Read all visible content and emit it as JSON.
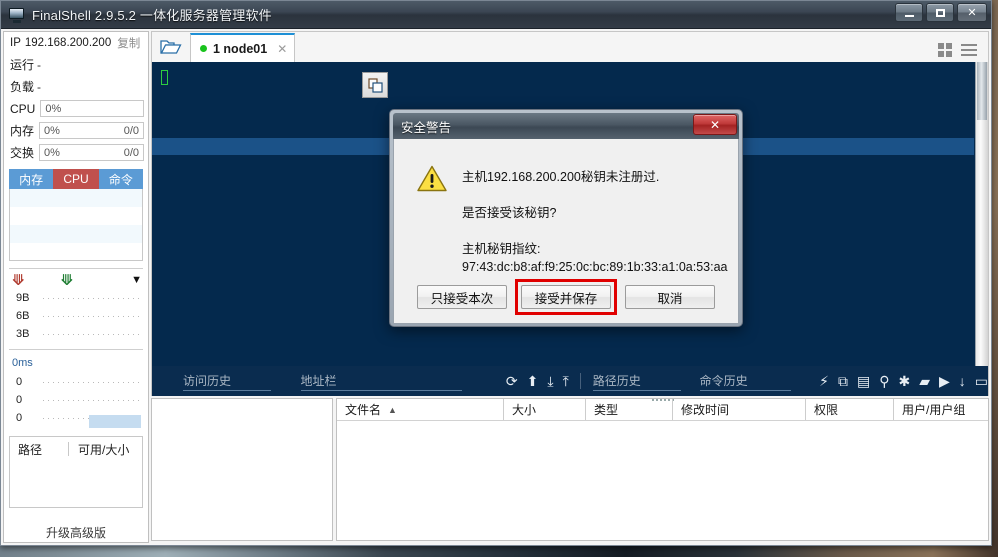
{
  "window": {
    "title": "FinalShell 2.9.5.2 一体化服务器管理软件",
    "icon": "monitor-icon",
    "minimize_label": "",
    "maximize_label": "",
    "close_label": "✕"
  },
  "sidebar": {
    "ip_label": "IP",
    "ip_value": "192.168.200.200",
    "copy_label": "复制",
    "uptime_label": "运行",
    "uptime_value": "-",
    "load_label": "负载",
    "load_value": "-",
    "meters": [
      {
        "label": "CPU",
        "percent": "0%",
        "detail": ""
      },
      {
        "label": "内存",
        "percent": "0%",
        "detail": "0/0"
      },
      {
        "label": "交换",
        "percent": "0%",
        "detail": "0/0"
      }
    ],
    "proc_tabs": [
      {
        "label": "内存",
        "active": false
      },
      {
        "label": "CPU",
        "active": true
      },
      {
        "label": "命令",
        "active": false
      }
    ],
    "net_up_icon": "arrow-up-icon",
    "net_down_icon": "arrow-down-icon",
    "net_menu_icon": "chevron-down-icon",
    "net_axis": [
      "9B",
      "6B",
      "3B"
    ],
    "latency_label": "0ms",
    "latency_axis": [
      "0",
      "0",
      "0"
    ],
    "disk_headers": [
      "路径",
      "可用/大小"
    ],
    "upgrade_label": "升级高级版"
  },
  "tabbar": {
    "folder_icon": "open-folder-icon",
    "tabs": [
      {
        "status": "connected",
        "label": "1 node01",
        "close": "✕"
      }
    ],
    "grid_view_icon": "grid-view-icon",
    "list_view_icon": "list-view-icon"
  },
  "terminal": {
    "background": "#04294d",
    "cursor_color": "#2ecc40",
    "selection_color": "#1b5288",
    "copy_icon": "copy-icon"
  },
  "sftp_toolbar": {
    "visit_history_placeholder": "访问历史",
    "address_bar_placeholder": "地址栏",
    "path_history_placeholder": "路径历史",
    "command_history_placeholder": "命令历史",
    "left_icons": [
      {
        "name": "refresh-icon",
        "glyph": "⟳"
      },
      {
        "name": "upload-arrow-icon",
        "glyph": "⬆"
      },
      {
        "name": "download-tray-icon",
        "glyph": "⤓"
      },
      {
        "name": "upload-tray-icon",
        "glyph": "⤒"
      }
    ],
    "right_icons": [
      {
        "name": "lightning-icon",
        "glyph": "⚡"
      },
      {
        "name": "copy-files-icon",
        "glyph": "⧉"
      },
      {
        "name": "paste-files-icon",
        "glyph": "▤"
      },
      {
        "name": "search-icon",
        "glyph": "⚲"
      },
      {
        "name": "gear-icon",
        "glyph": "✱"
      },
      {
        "name": "open-folder-icon",
        "glyph": "▰"
      },
      {
        "name": "play-icon",
        "glyph": "▶"
      },
      {
        "name": "download-icon",
        "glyph": "↓"
      },
      {
        "name": "window-icon",
        "glyph": "▭"
      }
    ]
  },
  "file_list": {
    "columns": [
      {
        "label": "文件名",
        "sorted": true,
        "sort_dir": "▲"
      },
      {
        "label": "大小"
      },
      {
        "label": "类型"
      },
      {
        "label": "修改时间"
      },
      {
        "label": "权限"
      },
      {
        "label": "用户/用户组"
      }
    ],
    "rows": []
  },
  "dialog": {
    "title": "安全警告",
    "close_label": "✕",
    "icon": "warning-triangle-icon",
    "line1": "主机192.168.200.200秘钥未注册过.",
    "line2": "是否接受该秘钥?",
    "line3": "主机秘钥指纹:",
    "fingerprint": "97:43:dc:b8:af:f9:25:0c:bc:89:1b:33:a1:0a:53:aa",
    "buttons": [
      {
        "label": "只接受本次",
        "highlighted": false
      },
      {
        "label": "接受并保存",
        "highlighted": true
      },
      {
        "label": "取消",
        "highlighted": false
      }
    ],
    "highlight_color": "#e00000"
  }
}
